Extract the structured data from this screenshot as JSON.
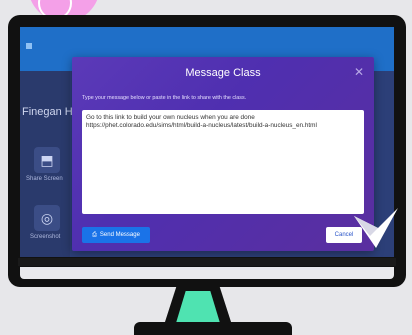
{
  "app": {
    "user_name": "Finegan Hi"
  },
  "sidebar": {
    "items": [
      {
        "label": "Share Screen",
        "icon": "share-screen-icon"
      },
      {
        "label": "Screenshot",
        "icon": "screenshot-icon"
      }
    ]
  },
  "modal": {
    "title": "Message Class",
    "instructions": "Type your message below or paste in the link to share with the class.",
    "message": "Go to this link to build your own nucleus when you are done https://phet.colorado.edu/sims/html/build-a-nucleus/latest/build-a-nucleus_en.html",
    "send_label": "Send Message",
    "cancel_label": "Cancel",
    "close_glyph": "✕"
  },
  "colors": {
    "accent_blue": "#1a73e8",
    "modal_purple": "#5b3ab8",
    "stand_green": "#4fe3b1",
    "blob_pink": "#f4a0e8"
  }
}
